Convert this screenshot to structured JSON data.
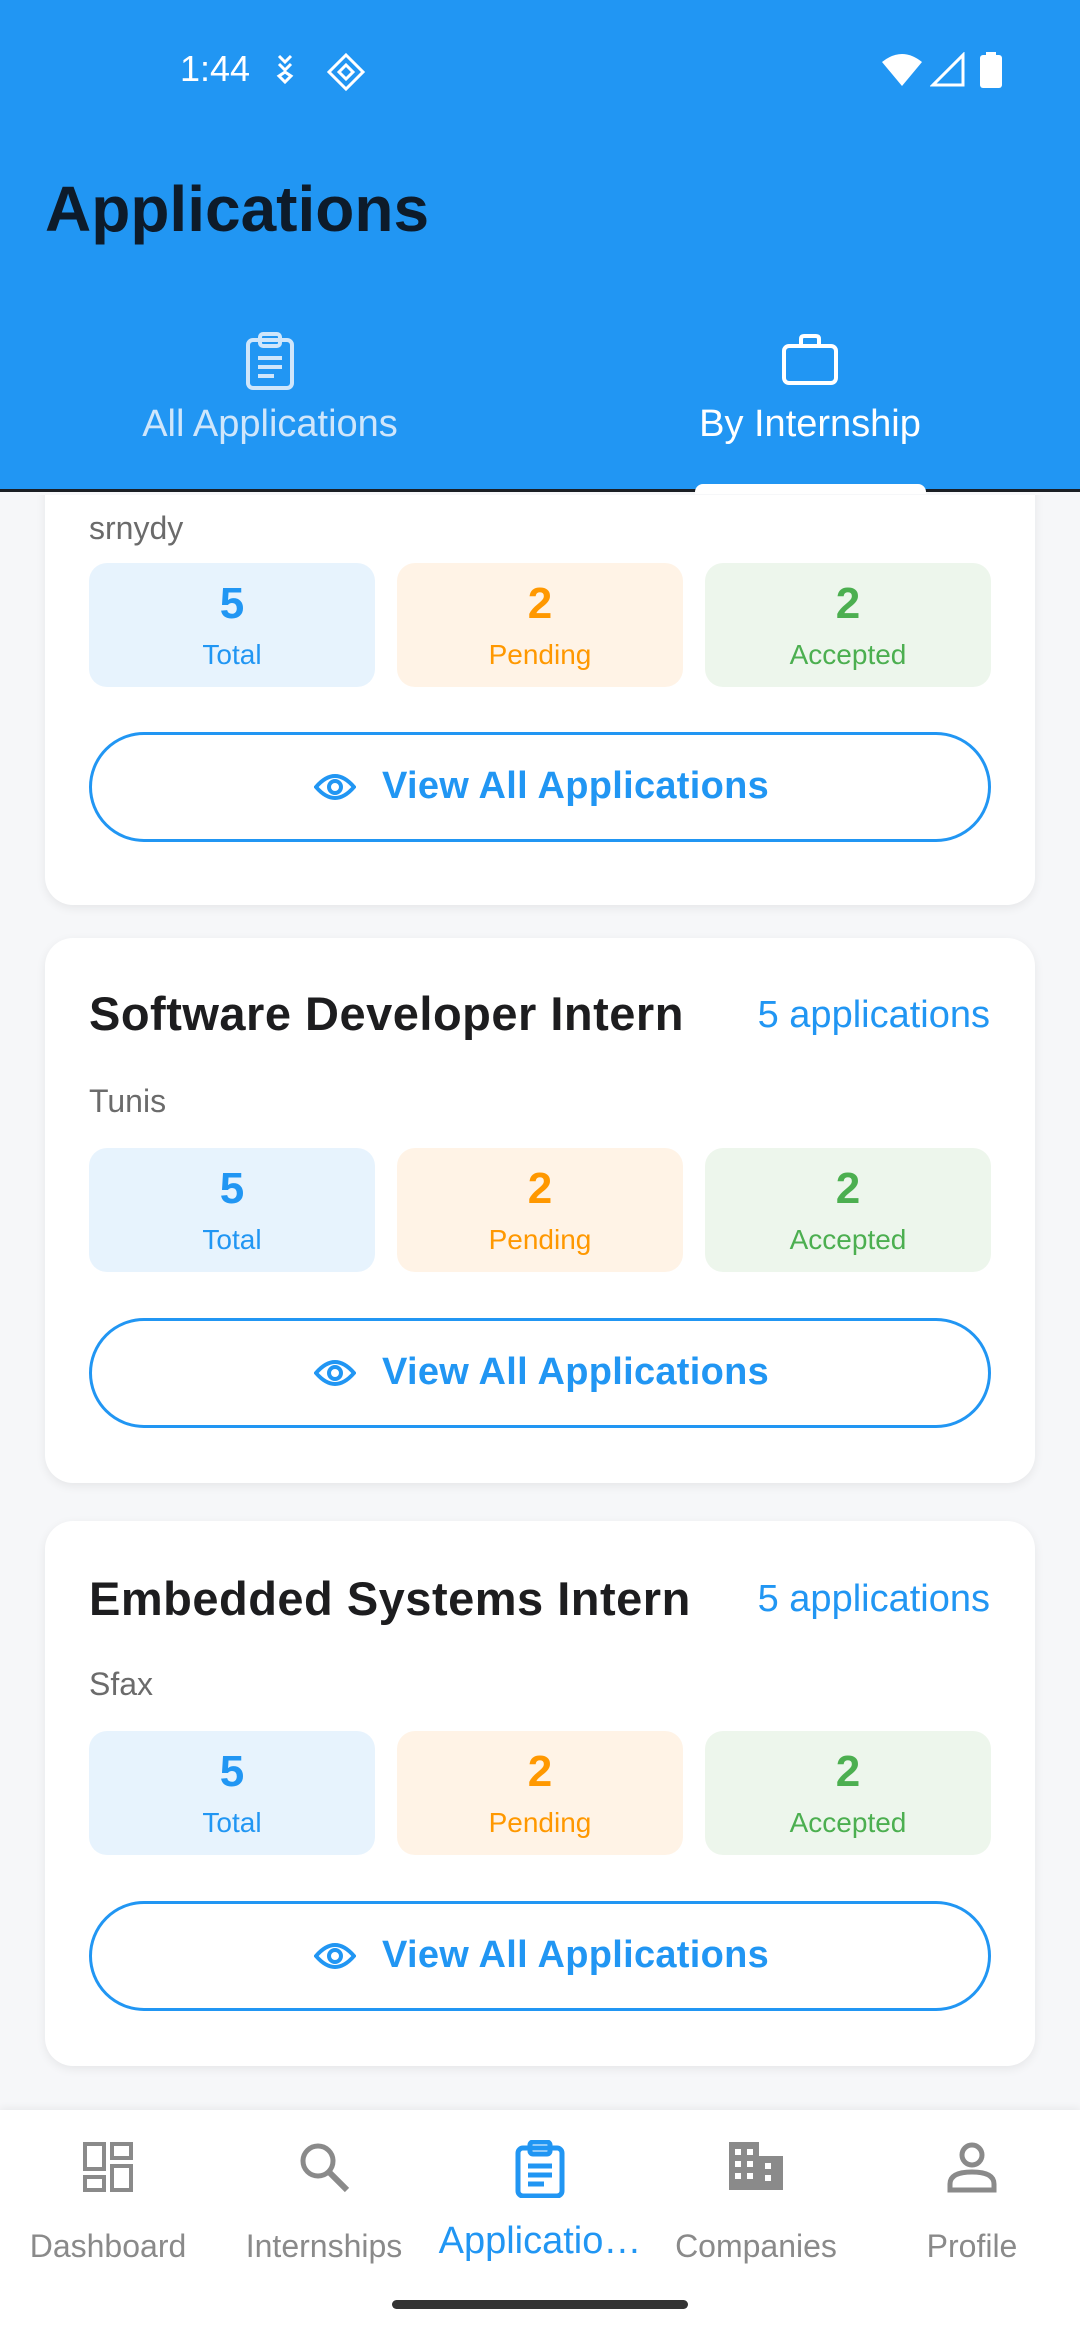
{
  "status_bar": {
    "time": "1:44"
  },
  "header": {
    "title": "Applications"
  },
  "tabs": [
    {
      "label": "All Applications",
      "icon": "clipboard-icon",
      "active": false
    },
    {
      "label": "By Internship",
      "icon": "briefcase-icon",
      "active": true
    }
  ],
  "cards": [
    {
      "location": "srnydy",
      "stats": {
        "total": "5",
        "total_label": "Total",
        "pending": "2",
        "pending_label": "Pending",
        "accepted": "2",
        "accepted_label": "Accepted"
      },
      "button_label": "View All Applications"
    },
    {
      "title": "Software Developer Intern",
      "count": "5 applications",
      "location": "Tunis",
      "stats": {
        "total": "5",
        "total_label": "Total",
        "pending": "2",
        "pending_label": "Pending",
        "accepted": "2",
        "accepted_label": "Accepted"
      },
      "button_label": "View All Applications"
    },
    {
      "title": "Embedded Systems Intern",
      "count": "5 applications",
      "location": "Sfax",
      "stats": {
        "total": "5",
        "total_label": "Total",
        "pending": "2",
        "pending_label": "Pending",
        "accepted": "2",
        "accepted_label": "Accepted"
      },
      "button_label": "View All Applications"
    }
  ],
  "bottom_nav": [
    {
      "label": "Dashboard",
      "icon": "dashboard-icon"
    },
    {
      "label": "Internships",
      "icon": "search-icon"
    },
    {
      "label": "Applicatio…",
      "icon": "clipboard-icon",
      "active": true
    },
    {
      "label": "Companies",
      "icon": "building-icon"
    },
    {
      "label": "Profile",
      "icon": "person-icon"
    }
  ],
  "colors": {
    "primary": "#2196F3",
    "pending": "#FF9800",
    "accepted": "#4CAF50"
  }
}
